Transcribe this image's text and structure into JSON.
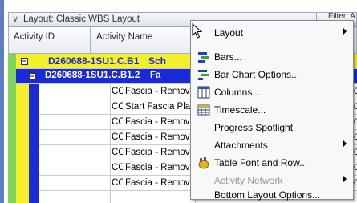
{
  "layout_bar": {
    "title": "Layout: Classic WBS Layout",
    "chevron": "∨"
  },
  "filter_header": {
    "text": "Filter: A\na\nor"
  },
  "columns": {
    "activity_id": "Activity ID",
    "activity_name": "Activity Name"
  },
  "wbs": [
    {
      "code": "D260688-1SU1.C.B1",
      "suffix": "Sch",
      "toggle": "−"
    },
    {
      "code": "D260688-1SU1.C.B1.2",
      "suffix": "Fa",
      "toggle": "−"
    }
  ],
  "activities": [
    {
      "id": "CC",
      "name": "Fascia - Remove Pai",
      "right": "0"
    },
    {
      "id": "CC",
      "name": "Start Fascia Plate Re",
      "right": "0"
    },
    {
      "id": "CC",
      "name": "Fascia - Remove Pla",
      "right": "0"
    },
    {
      "id": "CC",
      "name": "Fascia - Remove Pai",
      "right": "0"
    },
    {
      "id": "CC",
      "name": "Fascia - Remove Pla",
      "right": "0"
    },
    {
      "id": "CC",
      "name": "Fascia - Remove Pai",
      "right": "0"
    },
    {
      "id": "CC",
      "name": "Fascia - Remove Pla",
      "right": "0"
    }
  ],
  "context_menu": {
    "items": [
      {
        "label": "Layout",
        "icon": "none",
        "submenu": true,
        "enabled": true
      },
      {
        "label": "Bars...",
        "icon": "bars-icon",
        "submenu": false,
        "enabled": true
      },
      {
        "label": "Bar Chart Options...",
        "icon": "bar-chart-options-icon",
        "submenu": false,
        "enabled": true
      },
      {
        "label": "Columns...",
        "icon": "columns-icon",
        "submenu": false,
        "enabled": true
      },
      {
        "label": "Timescale...",
        "icon": "timescale-icon",
        "submenu": false,
        "enabled": true
      },
      {
        "label": "Progress Spotlight",
        "icon": "none",
        "submenu": false,
        "enabled": true
      },
      {
        "label": "Attachments",
        "icon": "none",
        "submenu": true,
        "enabled": true
      },
      {
        "label": "Table Font and Row...",
        "icon": "table-font-icon",
        "submenu": false,
        "enabled": true
      },
      {
        "label": "Activity Network",
        "icon": "none",
        "submenu": true,
        "enabled": false
      },
      {
        "label": "Bottom Layout Options...",
        "icon": "none",
        "submenu": false,
        "enabled": true
      }
    ]
  },
  "colors": {
    "wbs_level1": "#f4ef2a",
    "wbs_level2": "#1a2ad8",
    "accent_green": "#7fd35a"
  }
}
